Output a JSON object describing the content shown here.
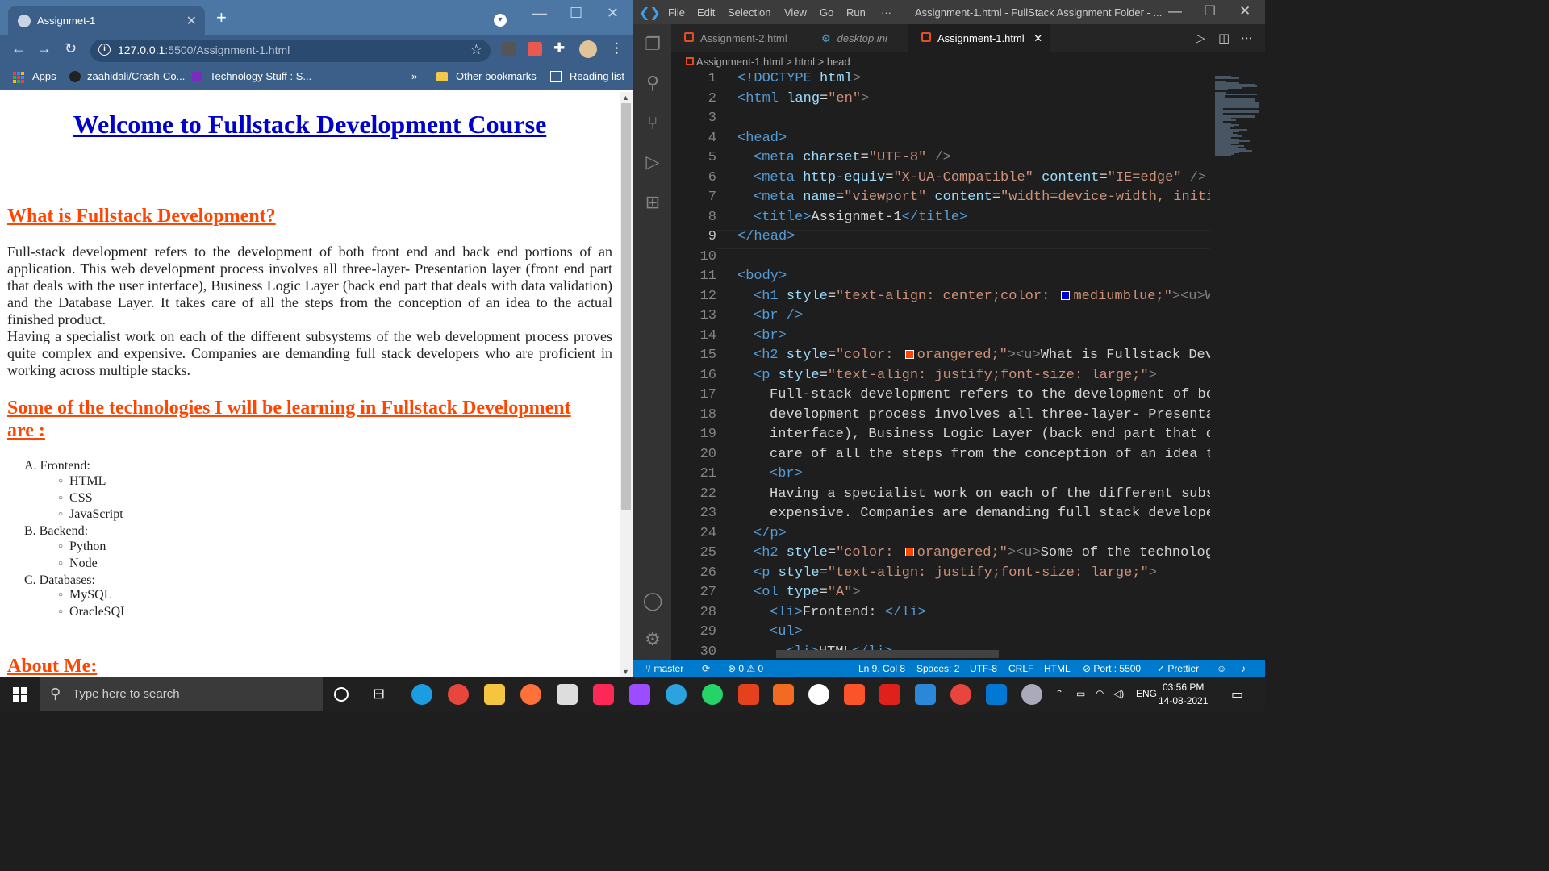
{
  "browser": {
    "tab_title": "Assignmet-1",
    "tab_close": "✕",
    "new_tab": "+",
    "url_host": "127.0.0.1",
    "url_rest": ":5500/Assignment-1.html",
    "bookmarks": {
      "apps": "Apps",
      "b1": "zaahidali/Crash-Co...",
      "b2": "Technology Stuff : S...",
      "more": "»",
      "other": "Other bookmarks",
      "reading": "Reading list"
    }
  },
  "page": {
    "h1": "Welcome to Fullstack Development Course",
    "h2_what": "What is Fullstack Development?",
    "p1": "Full-stack development refers to the development of both front end and back end portions of an application. This web development process involves all three-layer- Presentation layer (front end part that deals with the user interface), Business Logic Layer (back end part that deals with data validation) and the Database Layer. It takes care of all the steps from the conception of an idea to the actual finished product.",
    "p2": "Having a specialist work on each of the different subsystems of the web development process proves quite complex and expensive. Companies are demanding full stack developers who are proficient in working across multiple stacks.",
    "h2_tech": "Some of the technologies I will be learning in Fullstack Development are :",
    "list": [
      {
        "label": "A. Frontend:",
        "items": [
          "HTML",
          "CSS",
          "JavaScript"
        ]
      },
      {
        "label": "B. Backend:",
        "items": [
          "Python",
          "Node"
        ]
      },
      {
        "label": "C. Databases:",
        "items": [
          "MySQL",
          "OracleSQL"
        ]
      }
    ],
    "h2_about": "About Me:"
  },
  "vscode": {
    "menu": [
      "File",
      "Edit",
      "Selection",
      "View",
      "Go",
      "Run",
      "···"
    ],
    "window_title": "Assignment-1.html - FullStack Assignment Folder - ...",
    "tabs": [
      "Assignment-2.html",
      "desktop.ini",
      "Assignment-1.html"
    ],
    "tab_close": "✕",
    "breadcrumb": {
      "file": "Assignment-1.html",
      "sep1": ">",
      "html": "html",
      "sep2": ">",
      "head": "head"
    },
    "line_numbers": [
      "1",
      "2",
      "3",
      "4",
      "5",
      "6",
      "7",
      "8",
      "9",
      "10",
      "11",
      "12",
      "13",
      "14",
      "15",
      "16",
      "17",
      "18",
      "19",
      "20",
      "21",
      "22",
      "23",
      "24",
      "25",
      "26",
      "27",
      "28",
      "29",
      "30"
    ],
    "code": {
      "l1": [
        "<!DOCTYPE",
        " html",
        ">"
      ],
      "l2": [
        "<html",
        " lang",
        "=",
        "\"en\"",
        ">"
      ],
      "l4": [
        "<head>"
      ],
      "l5": [
        "<meta",
        " charset",
        "=",
        "\"UTF-8\"",
        " />"
      ],
      "l6": [
        "<meta",
        " http-equiv",
        "=",
        "\"X-UA-Compatible\"",
        " content",
        "=",
        "\"IE=edge\"",
        " />"
      ],
      "l7": [
        "<meta",
        " name",
        "=",
        "\"viewport\"",
        " content",
        "=",
        "\"width=device-width, initi"
      ],
      "l8": [
        "<title>",
        "Assignmet-1",
        "</title>"
      ],
      "l9": [
        "</head>"
      ],
      "l11": [
        "<body>"
      ],
      "l12": [
        "<h1",
        " style",
        "=",
        "\"text-align: center;color: ",
        "mediumblue;\"",
        "><u>W"
      ],
      "l13": [
        "<br />"
      ],
      "l14": [
        "<br>"
      ],
      "l15": [
        "<h2",
        " style",
        "=",
        "\"color: ",
        "orangered;\"",
        "><u>",
        "What is Fullstack Dev"
      ],
      "l16": [
        "<p",
        " style",
        "=",
        "\"text-align: justify;font-size: large;\"",
        ">"
      ],
      "l17": "Full-stack development refers to the development of bo",
      "l18": "development process involves all three-layer- Presenta",
      "l19": "interface), Business Logic Layer (back end part that d",
      "l20": "care of all the steps from the conception of an idea t",
      "l21": [
        "<br>"
      ],
      "l22": "Having a specialist work on each of the different subs",
      "l23": "expensive. Companies are demanding full stack develope",
      "l24": [
        "</p>"
      ],
      "l25": [
        "<h2",
        " style",
        "=",
        "\"color: ",
        "orangered;\"",
        "><u>",
        "Some of the technolog"
      ],
      "l26": [
        "<p",
        " style",
        "=",
        "\"text-align: justify;font-size: large;\"",
        ">"
      ],
      "l27": [
        "<ol",
        " type",
        "=",
        "\"A\"",
        ">"
      ],
      "l28": [
        "<li>",
        "Frontend: ",
        "</li>"
      ],
      "l29": [
        "<ul>"
      ],
      "l30": [
        "<li>",
        "HTML",
        "</li>"
      ]
    },
    "status": {
      "branch": "master",
      "errors": "0",
      "warnings": "0",
      "position": "Ln 9, Col 8",
      "spaces": "Spaces: 2",
      "encoding": "UTF-8",
      "eol": "CRLF",
      "lang": "HTML",
      "port": "Port : 5500",
      "prettier": "Prettier"
    }
  },
  "taskbar": {
    "search": "Type here to search",
    "lang": "ENG",
    "time": "03:56 PM",
    "date": "14-08-2021"
  },
  "colors": {
    "mediumblue": "#0000cd",
    "orangered": "#ff4500",
    "statusbar": "#007acc"
  }
}
